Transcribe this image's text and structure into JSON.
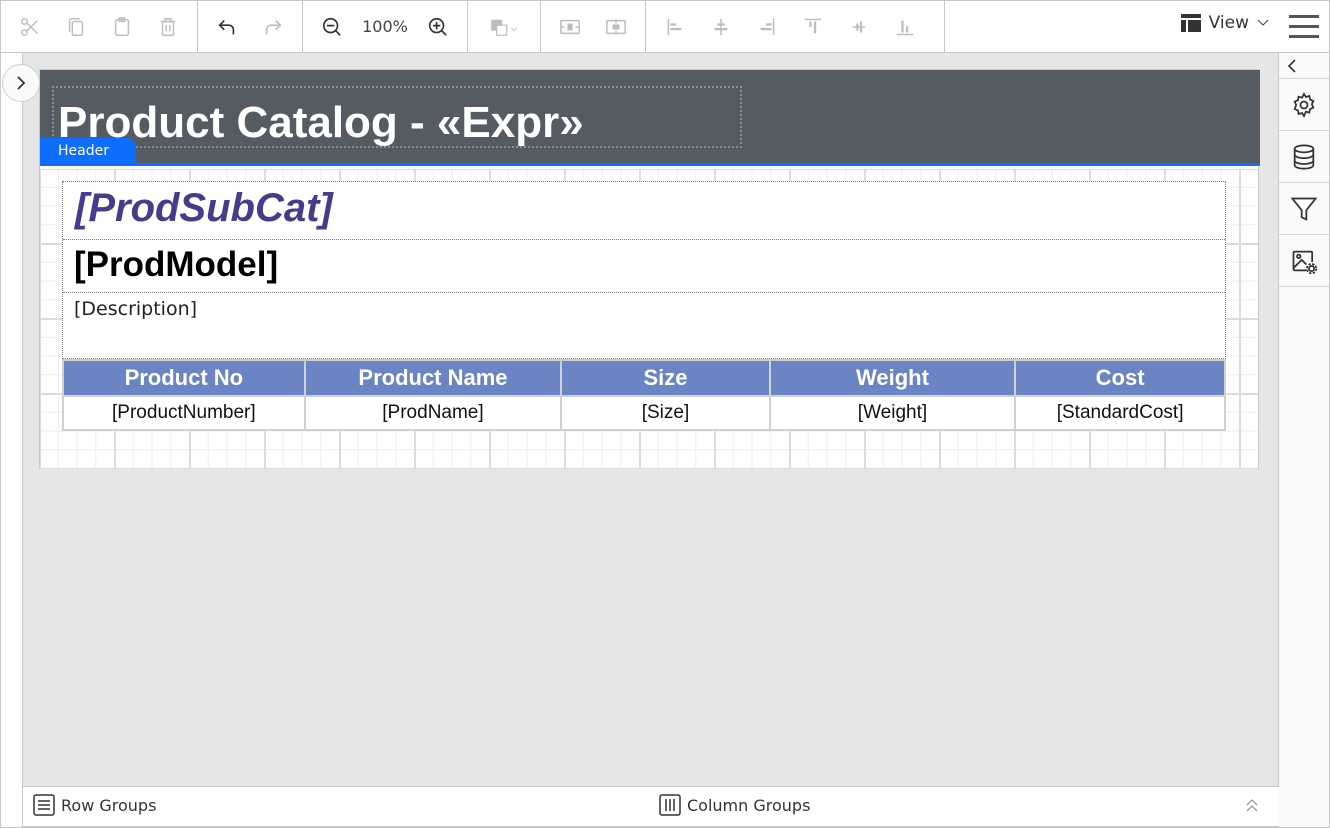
{
  "toolbar": {
    "groups": {
      "clipboard": [
        {
          "name": "cut",
          "icon": "scissors-icon",
          "enabled": false
        },
        {
          "name": "copy",
          "icon": "copy-icon",
          "enabled": false
        },
        {
          "name": "paste",
          "icon": "clipboard-icon",
          "enabled": false
        },
        {
          "name": "delete",
          "icon": "trash-icon",
          "enabled": false
        }
      ],
      "history": [
        {
          "name": "undo",
          "icon": "undo-icon",
          "enabled": true
        },
        {
          "name": "redo",
          "icon": "redo-icon",
          "enabled": false
        }
      ]
    },
    "zoom_level": "100%",
    "view_label": "View",
    "colors": {
      "enabled_icon": "#333333",
      "disabled_icon": "#bdbdbd"
    }
  },
  "report": {
    "header": {
      "title": "Product Catalog - «Expr»",
      "band_label": "Header",
      "background": "#555b63",
      "accent": "#0d6efd"
    },
    "list": {
      "subcategory": "[ProdSubCat]",
      "model": "[ProdModel]",
      "description": "[Description]",
      "subcategory_color": "#463c8c"
    },
    "table": {
      "header_color": "#6b84c4",
      "columns": [
        "Product No",
        "Product Name",
        "Size",
        "Weight",
        "Cost"
      ],
      "rows": [
        [
          "[ProductNumber]",
          "[ProdName]",
          "[Size]",
          "[Weight]",
          "[StandardCost]"
        ]
      ]
    }
  },
  "right_panel": {
    "items": [
      {
        "name": "properties",
        "icon": "gear-icon"
      },
      {
        "name": "data",
        "icon": "database-icon"
      },
      {
        "name": "filter",
        "icon": "filter-icon"
      },
      {
        "name": "image-settings",
        "icon": "image-settings-icon"
      }
    ]
  },
  "bottom_bar": {
    "row_groups_label": "Row Groups",
    "column_groups_label": "Column Groups"
  }
}
